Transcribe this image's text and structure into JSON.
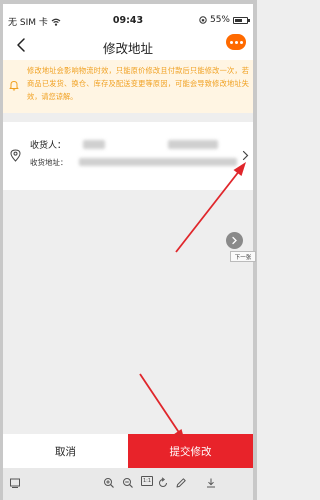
{
  "status_bar": {
    "carrier": "无 SIM 卡",
    "time": "09:43",
    "battery": "55%"
  },
  "nav": {
    "title": "修改地址"
  },
  "notice": {
    "text": "修改地址会影响物流时效，只能原价修改且付款后只能修改一次，若商品已发货、换仓、库存及配送变更等原因，可能会导致修改地址失效，请您谅解。"
  },
  "address": {
    "recipient_label": "收货人：",
    "address_label": "收货地址："
  },
  "next_button": {
    "label": "下一张"
  },
  "actions": {
    "cancel_label": "取消",
    "submit_label": "提交修改"
  },
  "colors": {
    "accent": "#e8232a",
    "notice_text": "#f0a020",
    "notice_bg": "#fff5e3",
    "annotation_arrow": "#e0262b"
  }
}
